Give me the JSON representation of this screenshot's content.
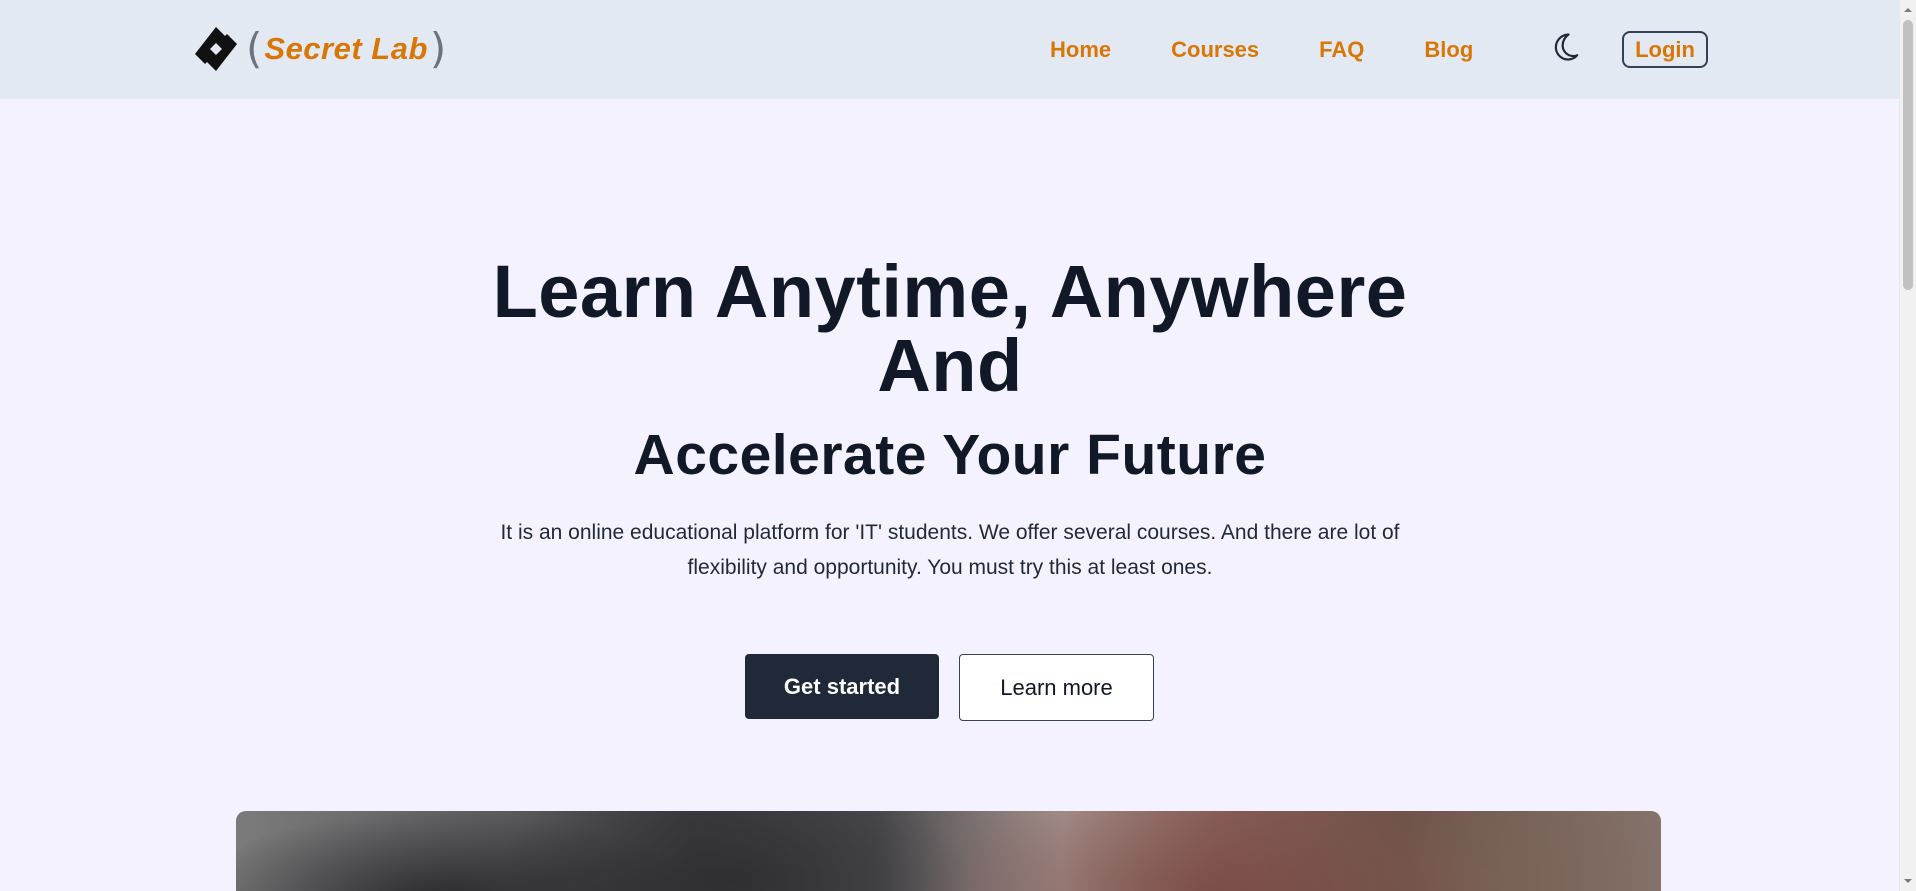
{
  "brand": {
    "bracket_left": "(",
    "name": "Secret Lab",
    "bracket_right": ")",
    "logo_icon": "diamond-logo-icon",
    "accent_color": "#d97706"
  },
  "nav": {
    "items": [
      {
        "label": "Home"
      },
      {
        "label": "Courses"
      },
      {
        "label": "FAQ"
      },
      {
        "label": "Blog"
      }
    ],
    "theme_icon": "moon-icon",
    "login_label": "Login"
  },
  "hero": {
    "title_line1": "Learn Anytime, Anywhere",
    "title_line2": "And",
    "subtitle": "Accelerate Your Future",
    "description": "It is an online educational platform for 'IT' students. We offer several courses. And there are lot of flexibility and opportunity. You must try this at least ones.",
    "primary_button": "Get started",
    "secondary_button": "Learn more"
  },
  "colors": {
    "page_bg": "#f4f2fe",
    "navbar_bg": "#e3e9f2",
    "heading": "#111827",
    "primary_button_bg": "#1f2937"
  }
}
